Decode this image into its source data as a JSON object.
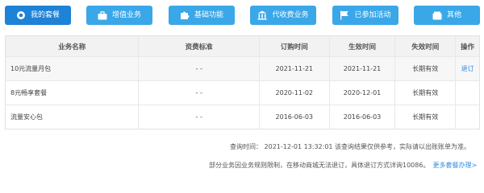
{
  "tabs": [
    {
      "label": "我的套餐",
      "icon": "radio-circle-icon",
      "active": true
    },
    {
      "label": "增值业务",
      "icon": "briefcase-icon",
      "active": false
    },
    {
      "label": "基础功能",
      "icon": "puzzle-icon",
      "active": false
    },
    {
      "label": "代收费业务",
      "icon": "bank-icon",
      "active": false
    },
    {
      "label": "已参加活动",
      "icon": "flag-icon",
      "active": false
    },
    {
      "label": "其他",
      "icon": "box-icon",
      "active": false
    }
  ],
  "table": {
    "headers": [
      "业务名称",
      "资费标准",
      "订购时间",
      "生效时间",
      "失效时间",
      "操作"
    ],
    "rows": [
      {
        "name": "10元流量月包",
        "fee": "- -",
        "order": "2021-11-21",
        "effective": "2021-11-21",
        "expire": "长期有效",
        "action": "退订"
      },
      {
        "name": "8元畅享套餐",
        "fee": "- -",
        "order": "2020-11-02",
        "effective": "2020-12-01",
        "expire": "长期有效",
        "action": ""
      },
      {
        "name": "流量安心包",
        "fee": "- -",
        "order": "2016-06-03",
        "effective": "2016-06-03",
        "expire": "长期有效",
        "action": ""
      }
    ]
  },
  "notes": {
    "query_time": "查询时间：  2021-12-01 13:32:01 该查询结果仅供参考，实际请以出账账单为准。",
    "rule": "部分业务因业务规则限制，在移动商城无法退订，具体退订方式详询10086。",
    "more_link": "更多套餐办理>"
  },
  "colors": {
    "tab": "#3aa7e8",
    "tab_active": "#1e82d6",
    "link": "#2d8be0"
  }
}
